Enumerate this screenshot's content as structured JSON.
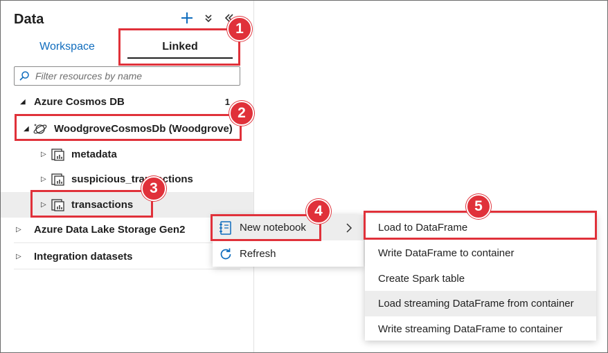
{
  "panel": {
    "title": "Data",
    "tabs": {
      "workspace": "Workspace",
      "linked": "Linked"
    },
    "filter_placeholder": "Filter resources by name"
  },
  "tree": {
    "cosmos": {
      "label": "Azure Cosmos DB",
      "count": "1"
    },
    "account": {
      "label": "WoodgroveCosmosDb (Woodgrove)"
    },
    "containers": [
      "metadata",
      "suspicious_transactions",
      "transactions"
    ],
    "adls": {
      "label": "Azure Data Lake Storage Gen2"
    },
    "integration": {
      "label": "Integration datasets"
    }
  },
  "context_menu": {
    "new_notebook": "New notebook",
    "refresh": "Refresh"
  },
  "submenu": {
    "items": [
      "Load to DataFrame",
      "Write DataFrame to container",
      "Create Spark table",
      "Load streaming DataFrame from container",
      "Write streaming DataFrame to container"
    ]
  },
  "callouts": [
    "1",
    "2",
    "3",
    "4",
    "5"
  ],
  "colors": {
    "accent": "#0f6cbd",
    "callout": "#e0313a",
    "selected_row": "#ededed"
  }
}
